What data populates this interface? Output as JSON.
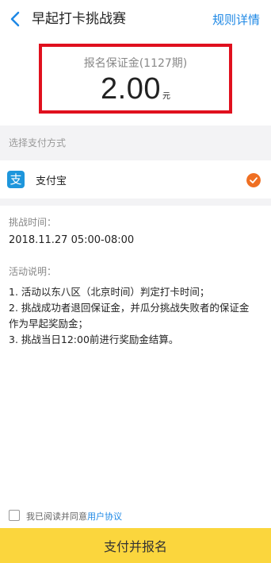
{
  "navbar": {
    "title": "早起打卡挑战赛",
    "rules_link": "规则详情",
    "back_icon": "back-chevron-icon"
  },
  "deposit": {
    "label": "报名保证金(1127期)",
    "amount": "2.00",
    "unit": "元"
  },
  "payment": {
    "section_title": "选择支付方式",
    "method_label": "支付宝",
    "method_icon": "alipay-icon",
    "selected": true,
    "accent_color": "#ef6f22"
  },
  "challenge": {
    "time_label": "挑战时间：",
    "time_value": "2018.11.27 05:00-08:00",
    "desc_label": "活动说明：",
    "rules": [
      "1. 活动以东八区（北京时间）判定打卡时间；",
      "2. 挑战成功者退回保证金，并瓜分挑战失败者的保证金",
      "作为早起奖励金；",
      "3. 挑战当日12:00前进行奖励金结算。"
    ]
  },
  "agreement": {
    "checked": false,
    "text": "我已阅读并同意",
    "link": "用户协议"
  },
  "submit": {
    "label": "支付并报名",
    "color": "#fbd63d"
  },
  "colors": {
    "link": "#1e88e5",
    "highlight_border": "#e0101e",
    "section_bg": "#f3f3f5"
  }
}
